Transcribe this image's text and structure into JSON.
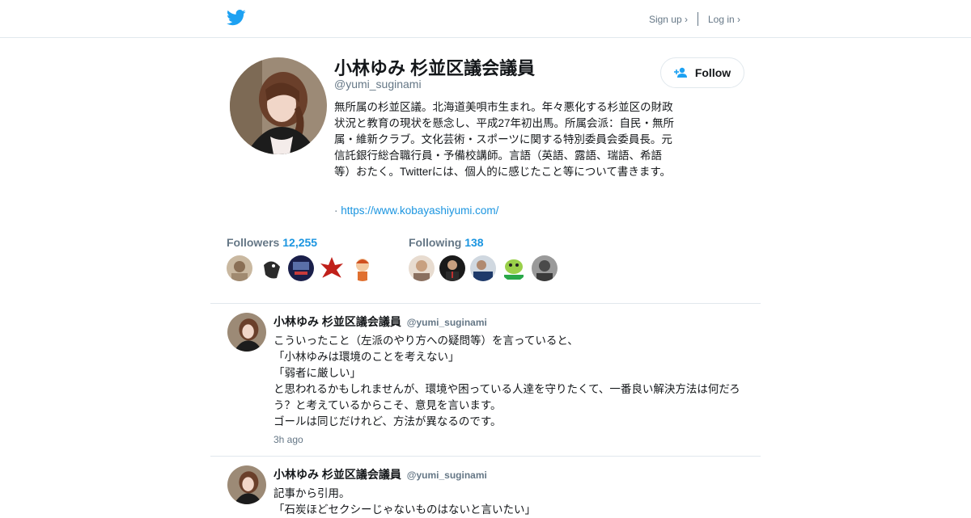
{
  "header": {
    "signup_label": "Sign up ›",
    "login_label": "Log in ›"
  },
  "profile": {
    "name": "小林ゆみ 杉並区議会議員",
    "handle": "@yumi_suginami",
    "follow_label": "Follow",
    "bio": "無所属の杉並区議。北海道美唄市生まれ。年々悪化する杉並区の財政状況と教育の現状を懸念し、平成27年初出馬。所属会派：自民・無所属・維新クラブ。文化芸術・スポーツに関する特別委員会委員長。元信託銀行総合職行員・予備校講師。言語（英語、露語、瑞語、希語等）おたく。Twitterには、個人的に感じたこと等について書きます。",
    "url_prefix": "·",
    "url": "https://www.kobayashiyumi.com/"
  },
  "stats": {
    "followers_label": "Followers",
    "followers_count": "12,255",
    "following_label": "Following",
    "following_count": "138"
  },
  "tweets": [
    {
      "name": "小林ゆみ 杉並区議会議員",
      "handle": "@yumi_suginami",
      "lines": [
        "こういったこと（左派のやり方への疑問等）を言っていると、",
        "「小林ゆみは環境のことを考えない」",
        "「弱者に厳しい」",
        "と思われるかもしれませんが、環境や困っている人達を守りたくて、一番良い解決方法は何だろう？と考えているからこそ、意見を言います。",
        "ゴールは同じだけれど、方法が異なるのです。"
      ],
      "time": "3h ago"
    },
    {
      "name": "小林ゆみ 杉並区議会議員",
      "handle": "@yumi_suginami",
      "lines": [
        "記事から引用。",
        "「石炭ほどセクシーじゃないものはないと言いたい」"
      ]
    }
  ],
  "colors": {
    "brand": "#1da1f2",
    "link": "#1b95e0",
    "muted": "#657786",
    "border": "#e1e8ed"
  }
}
